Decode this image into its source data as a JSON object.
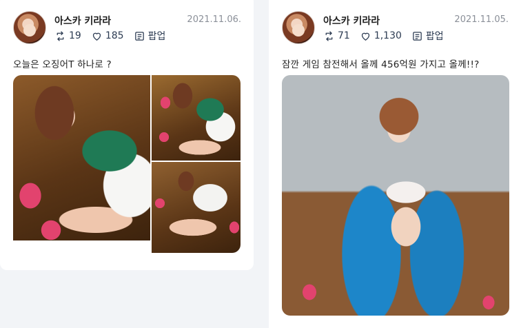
{
  "posts": [
    {
      "author": "아스카 키라라",
      "date": "2021.11.06.",
      "retweets": "19",
      "likes": "185",
      "popup_label": "팝업",
      "text": "오늘은 오징어T 하나로 ?",
      "photos": [
        "photo-1",
        "photo-2",
        "photo-3"
      ]
    },
    {
      "author": "아스카 키라라",
      "date": "2021.11.05.",
      "retweets": "71",
      "likes": "1,130",
      "popup_label": "팝업",
      "text": "잠깐 게임 참전해서 올께 456억원 가지고 올께!!?",
      "photos": [
        "photo-1"
      ]
    }
  ],
  "colors": {
    "background": "#f2f4f7",
    "card": "#ffffff",
    "icon": "#2c3b52",
    "date": "#8a8f98"
  },
  "icons": {
    "retweet": "retweet-icon",
    "like": "heart-icon",
    "popup": "popup-icon"
  }
}
